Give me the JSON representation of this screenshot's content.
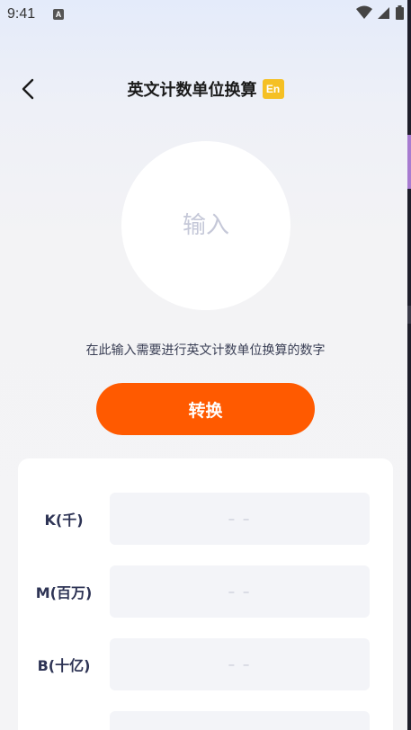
{
  "status_bar": {
    "time": "9:41",
    "notification_letter": "A"
  },
  "header": {
    "title": "英文计数单位换算",
    "badge": "En"
  },
  "input": {
    "placeholder": "输入",
    "value": ""
  },
  "hint": "在此输入需要进行英文计数单位换算的数字",
  "convert_button": "转换",
  "results": [
    {
      "label": "K(千)",
      "value": "– –"
    },
    {
      "label": "M(百万)",
      "value": "– –"
    },
    {
      "label": "B(十亿)",
      "value": "– –"
    },
    {
      "label": "",
      "value": ""
    }
  ],
  "colors": {
    "accent": "#ff5a00",
    "badge": "#f5c024"
  }
}
